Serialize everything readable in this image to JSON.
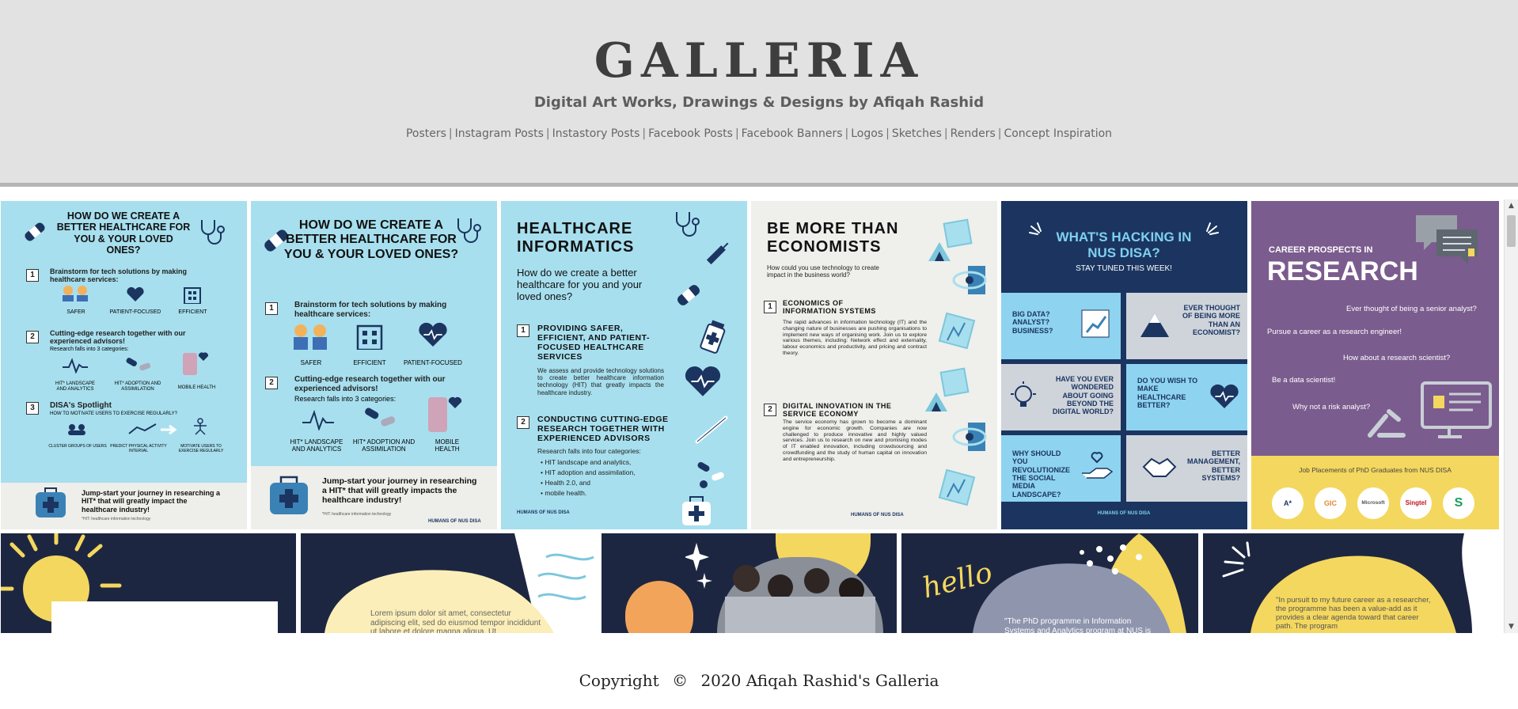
{
  "header": {
    "title": "GALLERIA",
    "tagline": "Digital Art Works, Drawings & Designs by Afiqah Rashid",
    "nav": [
      {
        "label": "Posters"
      },
      {
        "label": "Instagram Posts"
      },
      {
        "label": "Instastory Posts"
      },
      {
        "label": "Facebook Posts"
      },
      {
        "label": "Facebook Banners"
      },
      {
        "label": "Logos"
      },
      {
        "label": "Sketches"
      },
      {
        "label": "Renders"
      },
      {
        "label": "Concept Inspiration"
      }
    ],
    "separator": "|"
  },
  "posters": {
    "p1": {
      "title": "HOW DO WE CREATE A BETTER HEALTHCARE FOR YOU & YOUR LOVED ONES?",
      "step1": "Brainstorm for tech solutions by making healthcare services:",
      "labels1": [
        "SAFER",
        "PATIENT-FOCUSED",
        "EFFICIENT"
      ],
      "step2": "Cutting-edge research together with our experienced advisors!",
      "step2_sub": "Research falls into 3 categories:",
      "labels2": [
        "HIT* LANDSCAPE AND ANALYTICS",
        "HIT* ADOPTION AND ASSIMILATION",
        "MOBILE HEALTH"
      ],
      "step3": "DISA's Spotlight",
      "step3_sub": "HOW TO MOTIVATE USERS TO EXERCISE REGULARLY?",
      "labels3": [
        "CLUSTER GROUPS OF USERS",
        "PREDICT PHYSICAL ACTIVITY INTERVAL",
        "MOTIVATE USERS TO EXERCISE REGULARLY"
      ],
      "cta": "Jump-start your journey in researching a HIT* that will greatly impact the healthcare industry!",
      "footnote": "*HIT: healthcare information technology"
    },
    "p2": {
      "title": "HOW DO WE CREATE A BETTER HEALTHCARE FOR YOU & YOUR LOVED ONES?",
      "step1": "Brainstorm for tech solutions by making healthcare services:",
      "labels1": [
        "SAFER",
        "EFFICIENT",
        "PATIENT-FOCUSED"
      ],
      "step2": "Cutting-edge research together with our experienced advisors!",
      "step2_sub": "Research falls into 3 categories:",
      "labels2": [
        "HIT* LANDSCAPE AND ANALYTICS",
        "HIT* ADOPTION AND ASSIMILATION",
        "MOBILE HEALTH"
      ],
      "cta": "Jump-start your journey in researching a HIT* that will greatly impacts the healthcare industry!",
      "footnote": "*HIT: healthcare information technology",
      "brand": "HUMANS OF NUS DISA"
    },
    "p3": {
      "title": "HEALTHCARE INFORMATICS",
      "subtitle": "How do we create a better healthcare for you and your loved ones?",
      "s1_title": "PROVIDING SAFER, EFFICIENT, AND PATIENT-FOCUSED HEALTHCARE SERVICES",
      "s1_body": "We assess and provide technology solutions to create better healthcare information technology (HIT) that greatly impacts the healthcare industry.",
      "s2_title": "CONDUCTING CUTTING-EDGE RESEARCH TOGETHER WITH EXPERIENCED ADVISORS",
      "s2_sub": "Research falls into four categories:",
      "s2_list": [
        "HIT landscape and analytics,",
        "HIT adoption and assimilation,",
        "Health 2.0, and",
        "mobile health."
      ],
      "brand": "HUMANS OF NUS DISA"
    },
    "p4": {
      "title": "BE MORE THAN ECONOMISTS",
      "subtitle": "How could you use technology to create impact in the business world?",
      "s1_title": "ECONOMICS OF INFORMATION SYSTEMS",
      "s1_body": "The rapid advances in information technology (IT) and the changing nature of businesses are pushing organisations to implement new ways of organising work. Join us to explore various themes, including: Network effect and externality, labour economics and productivity, and pricing and contract theory.",
      "s2_title": "DIGITAL INNOVATION IN THE SERVICE ECONOMY",
      "s2_body": "The service economy has grown to become a dominant engine for economic growth. Companies are now challenged to produce innovative and highly valued services. Join us to research on new and promising modes of IT enabled innovation, including crowdsourcing and crowdfunding and the study of human capital on innovation and entrepreneurship.",
      "brand": "HUMANS OF NUS DISA"
    },
    "p5": {
      "title": "WHAT'S HACKING IN NUS DISA?",
      "subtitle": "STAY TUNED THIS WEEK!",
      "cells": [
        "BIG DATA? ANALYST? BUSINESS?",
        "EVER THOUGHT OF BEING MORE THAN AN ECONOMIST?",
        "HAVE YOU EVER WONDERED ABOUT GOING BEYOND THE DIGITAL WORLD?",
        "DO YOU WISH TO MAKE HEALTHCARE BETTER?",
        "WHY SHOULD YOU REVOLUTIONIZE THE SOCIAL MEDIA LANDSCAPE?",
        "BETTER MANAGEMENT, BETTER SYSTEMS?"
      ],
      "brand": "HUMANS OF NUS DISA"
    },
    "p6": {
      "pre": "CAREER PROSPECTS IN",
      "title": "RESEARCH",
      "q": [
        "Ever thought of being a senior analyst?",
        "Pursue a career as a research engineer!",
        "How about a research scientist?",
        "Be a data scientist!",
        "Why not a risk analyst?"
      ],
      "placements": "Job Placements of PhD Graduates from NUS DISA",
      "logos": [
        "A*",
        "GIC",
        "Microsoft",
        "Singtel",
        "S"
      ]
    },
    "r2": {
      "lorem": "Lorem ipsum dolor sit amet, consectetur adipiscing elit, sed do eiusmod tempor incididunt ut labore et dolore magna aliqua. Ut",
      "hello": "hello",
      "quote1": "\"The PhD programme in Information Systems and Analytics program at NUS is",
      "quote2": "\"In pursuit to my future career as a researcher, the programme has been a value-add as it provides a clear agenda toward that career path. The program"
    }
  },
  "colors": {
    "header_bg": "#e2e2e2",
    "light_blue": "#a7dfee",
    "navy": "#1b3560",
    "dark_navy": "#1d2641",
    "purple": "#7b5c8e",
    "yellow": "#f4d75e"
  },
  "footer": {
    "copyright_label": "Copyright",
    "copyright_symbol": "©",
    "copyright_text": "2020 Afiqah Rashid's Galleria"
  }
}
